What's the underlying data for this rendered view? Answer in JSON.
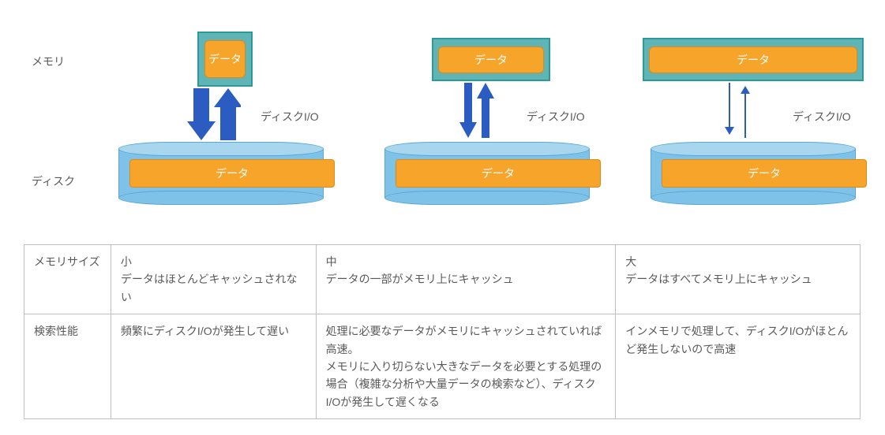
{
  "labels": {
    "memory": "メモリ",
    "disk": "ディスク",
    "data": "データ",
    "diskio": "ディスクI/O"
  },
  "columns": [
    {
      "arrow_weight": "thick"
    },
    {
      "arrow_weight": "medium"
    },
    {
      "arrow_weight": "thin"
    }
  ],
  "table": {
    "row1_label": "メモリサイズ",
    "row2_label": "検索性能",
    "cells": {
      "r1c1_title": "小",
      "r1c1_body": "データはほとんどキャッシュされない",
      "r1c2_title": "中",
      "r1c2_body": "データの一部がメモリ上にキャッシュ",
      "r1c3_title": "大",
      "r1c3_body": "データはすべてメモリ上にキャッシュ",
      "r2c1": "頻繁にディスクI/Oが発生して遅い",
      "r2c2": "処理に必要なデータがメモリにキャッシュされていれば高速。\nメモリに入り切らない大きなデータを必要とする処理の場合（複雑な分析や大量データの検索など）、ディスクI/Oが発生して遅くなる",
      "r2c3": "インメモリで処理して、ディスクI/Oがほとんど発生しないので高速"
    }
  }
}
